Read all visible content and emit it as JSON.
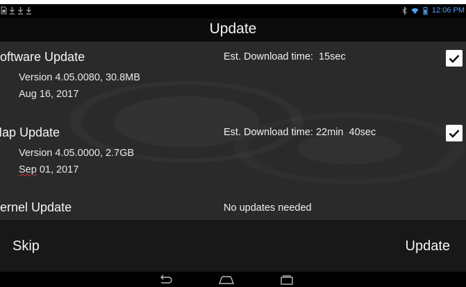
{
  "status_bar": {
    "time": "12:06 PM",
    "left_icons": [
      "sd-card-icon",
      "download-icon",
      "download-icon",
      "download-icon"
    ],
    "right_icons": [
      "bluetooth-icon",
      "wifi-icon",
      "battery-icon"
    ]
  },
  "title": "Update",
  "updates": [
    {
      "title": "Software Update",
      "version": "Version 4.05.0080, 30.8MB",
      "date": "Aug 16, 2017",
      "est_label": "Est. Download time:",
      "est_value": "15sec",
      "checked": true
    },
    {
      "title": "Map Update",
      "version": "Version 4.05.0000, 2.7GB",
      "date_prefix": "Sep",
      "date_rest": " 01, 2017",
      "est_label": "Est. Download time:",
      "est_value": "22min  40sec",
      "checked": true
    },
    {
      "title": "Kernel Update",
      "status": "No updates needed"
    }
  ],
  "actions": {
    "skip": "Skip",
    "update": "Update"
  },
  "nav": [
    "back-icon",
    "home-icon",
    "recents-icon"
  ],
  "colors": {
    "accent_time": "#4aa3ff",
    "background": "#2a2a2a",
    "title_bar": "#0c0c0c",
    "action_bar": "#181818"
  }
}
